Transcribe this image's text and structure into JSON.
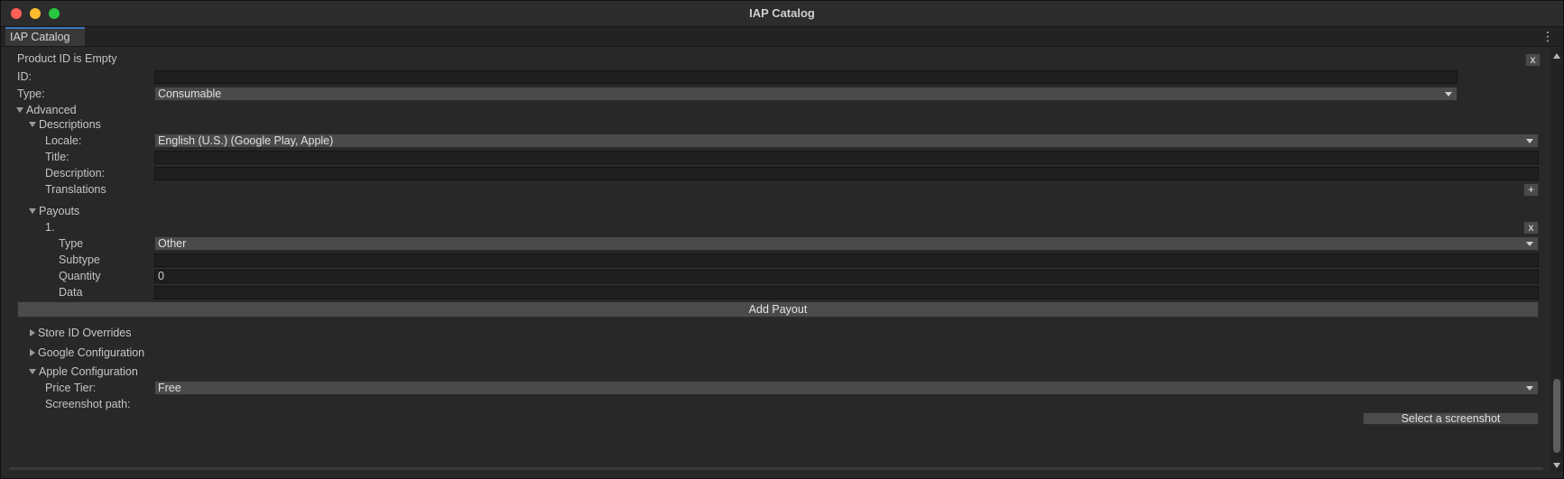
{
  "window": {
    "title": "IAP Catalog"
  },
  "tab": {
    "label": "IAP Catalog",
    "menu_glyph": "⋮"
  },
  "product": {
    "header": "Product ID is Empty",
    "remove_label": "x",
    "id_label": "ID:",
    "id_value": "",
    "type_label": "Type:",
    "type_value": "Consumable"
  },
  "advanced": {
    "label": "Advanced",
    "descriptions": {
      "label": "Descriptions",
      "locale_label": "Locale:",
      "locale_value": "English (U.S.) (Google Play, Apple)",
      "title_label": "Title:",
      "title_value": "",
      "description_label": "Description:",
      "description_value": "",
      "translations_label": "Translations",
      "add_translation_label": "+"
    },
    "payouts": {
      "label": "Payouts",
      "items": [
        {
          "index_label": "1.",
          "remove_label": "x",
          "type_label": "Type",
          "type_value": "Other",
          "subtype_label": "Subtype",
          "subtype_value": "",
          "quantity_label": "Quantity",
          "quantity_value": "0",
          "data_label": "Data",
          "data_value": ""
        }
      ],
      "add_payout_label": "Add Payout"
    },
    "store_id_overrides": {
      "label": "Store ID Overrides"
    },
    "google_configuration": {
      "label": "Google Configuration"
    },
    "apple_configuration": {
      "label": "Apple Configuration",
      "price_tier_label": "Price Tier:",
      "price_tier_value": "Free",
      "screenshot_path_label": "Screenshot path:",
      "select_screenshot_label": "Select a screenshot"
    }
  },
  "colors": {
    "accent": "#3a79bb",
    "window_bg": "#282828",
    "field_bg": "#1f1f1f",
    "button_bg": "#4a4a4a"
  }
}
